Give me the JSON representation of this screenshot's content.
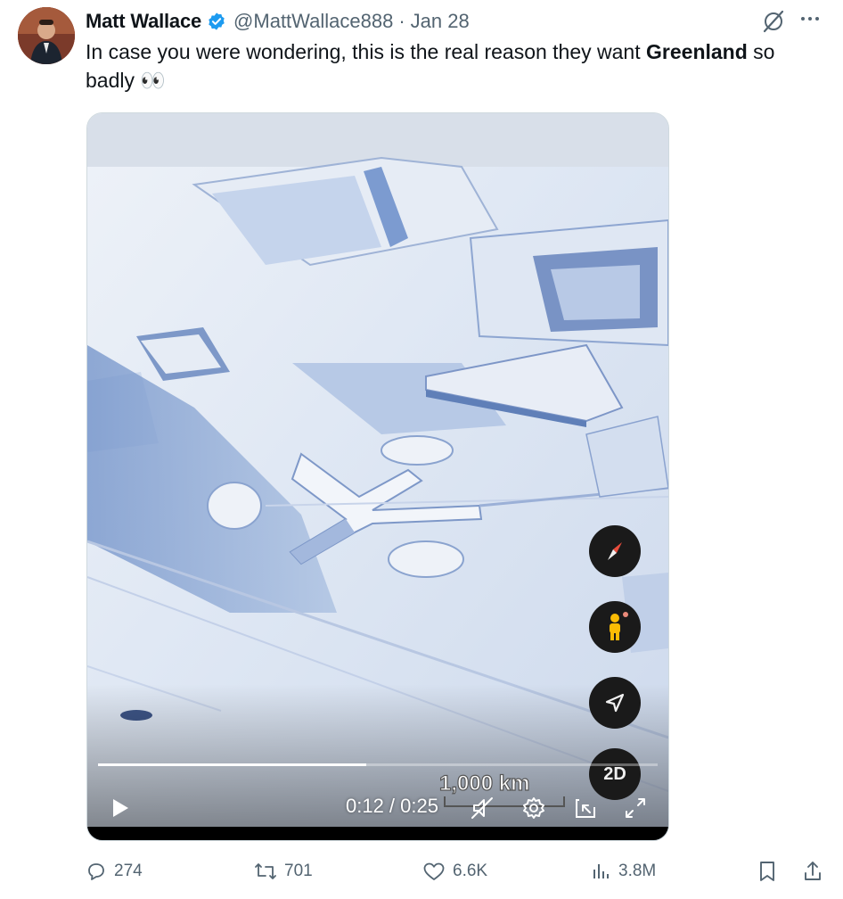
{
  "post": {
    "author_name": "Matt Wallace",
    "handle": "@MattWallace888",
    "separator": "·",
    "date": "Jan 28",
    "text_part1": "In case you were wondering, this is the real reason they want ",
    "text_bold": "Greenland",
    "text_part2": " so badly",
    "emoji": "👀"
  },
  "video": {
    "time": "0:12 / 0:25",
    "progress": 0.48,
    "scale_label": "1,000 km",
    "btn_2d": "2D"
  },
  "actions": {
    "replies": "274",
    "reposts": "701",
    "likes": "6.6K",
    "views": "3.8M"
  },
  "icons": {
    "verified": "verified-badge-icon",
    "grok": "grok-icon",
    "more": "more-icon",
    "compass": "compass-icon",
    "pegman": "pegman-icon",
    "locate": "locate-arrow-icon",
    "play": "play-icon",
    "mute": "mute-icon",
    "settings": "gear-icon",
    "pip": "pip-icon",
    "fullscreen": "fullscreen-icon",
    "reply": "reply-icon",
    "repost": "repost-icon",
    "like": "heart-icon",
    "views": "views-icon",
    "bookmark": "bookmark-icon",
    "share": "share-icon"
  },
  "colors": {
    "verified": "#1d9bf0",
    "text": "#0f1419",
    "secondary": "#536471"
  }
}
